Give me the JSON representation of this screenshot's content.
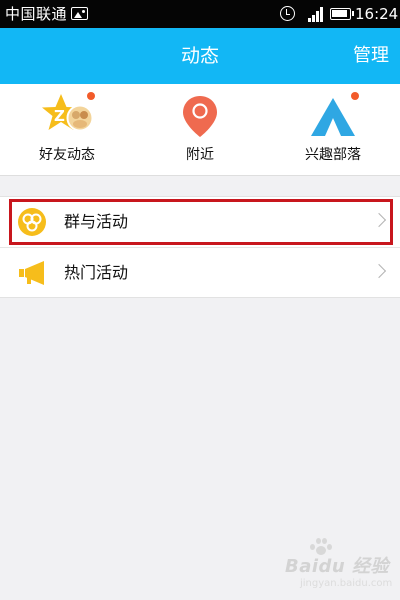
{
  "status_bar": {
    "carrier": "中国联通",
    "time": "16:24",
    "icons": [
      "image-icon",
      "alarm-icon",
      "signal-icon",
      "battery-icon"
    ]
  },
  "header": {
    "title": "动态",
    "manage_label": "管理",
    "color": "#12b7f5"
  },
  "shortcuts": [
    {
      "label": "好友动态",
      "icon": "star-friends-icon",
      "has_badge": true
    },
    {
      "label": "附近",
      "icon": "location-pin-icon",
      "has_badge": false
    },
    {
      "label": "兴趣部落",
      "icon": "tent-icon",
      "has_badge": true
    }
  ],
  "list": [
    {
      "label": "群与活动",
      "icon": "group-icon",
      "highlighted": true
    },
    {
      "label": "热门活动",
      "icon": "megaphone-icon",
      "highlighted": false
    }
  ],
  "watermark": {
    "text": "Baidu 经验",
    "url": "jingyan.baidu.com"
  },
  "colors": {
    "badge": "#f25b2a",
    "highlight_border": "#c8161d",
    "accent_yellow": "#f6bd1b"
  }
}
